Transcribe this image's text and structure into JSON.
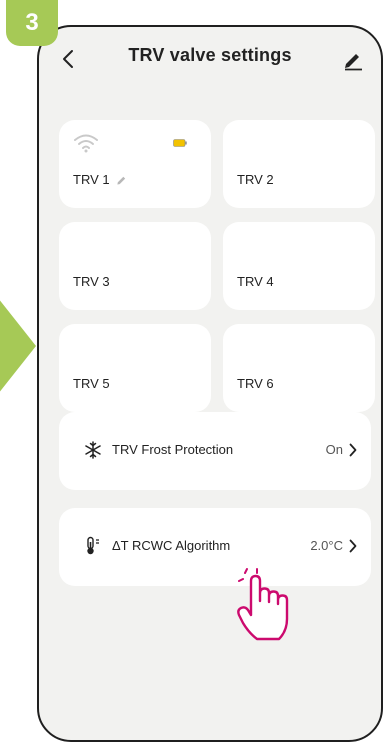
{
  "step": {
    "number": "3"
  },
  "header": {
    "title": "TRV valve settings",
    "back_icon": "chevron-left-icon",
    "edit_icon": "pencil-icon"
  },
  "trv_tiles": [
    {
      "label": "TRV 1",
      "has_wifi": true,
      "battery": true,
      "editable": true
    },
    {
      "label": "TRV 2"
    },
    {
      "label": "TRV 3"
    },
    {
      "label": "TRV 4"
    },
    {
      "label": "TRV 5"
    },
    {
      "label": "TRV 6"
    }
  ],
  "settings": [
    {
      "icon": "snowflake-icon",
      "label": "TRV Frost Protection",
      "value": "On"
    },
    {
      "icon": "thermometer-icon",
      "label": "ΔT RCWC Algorithm",
      "value": "2.0°C"
    }
  ],
  "colors": {
    "accent_green": "#a6c956",
    "cursor_magenta": "#cc0a6e",
    "background": "#f2f2f0",
    "card": "#ffffff",
    "battery": "#f2c200"
  }
}
